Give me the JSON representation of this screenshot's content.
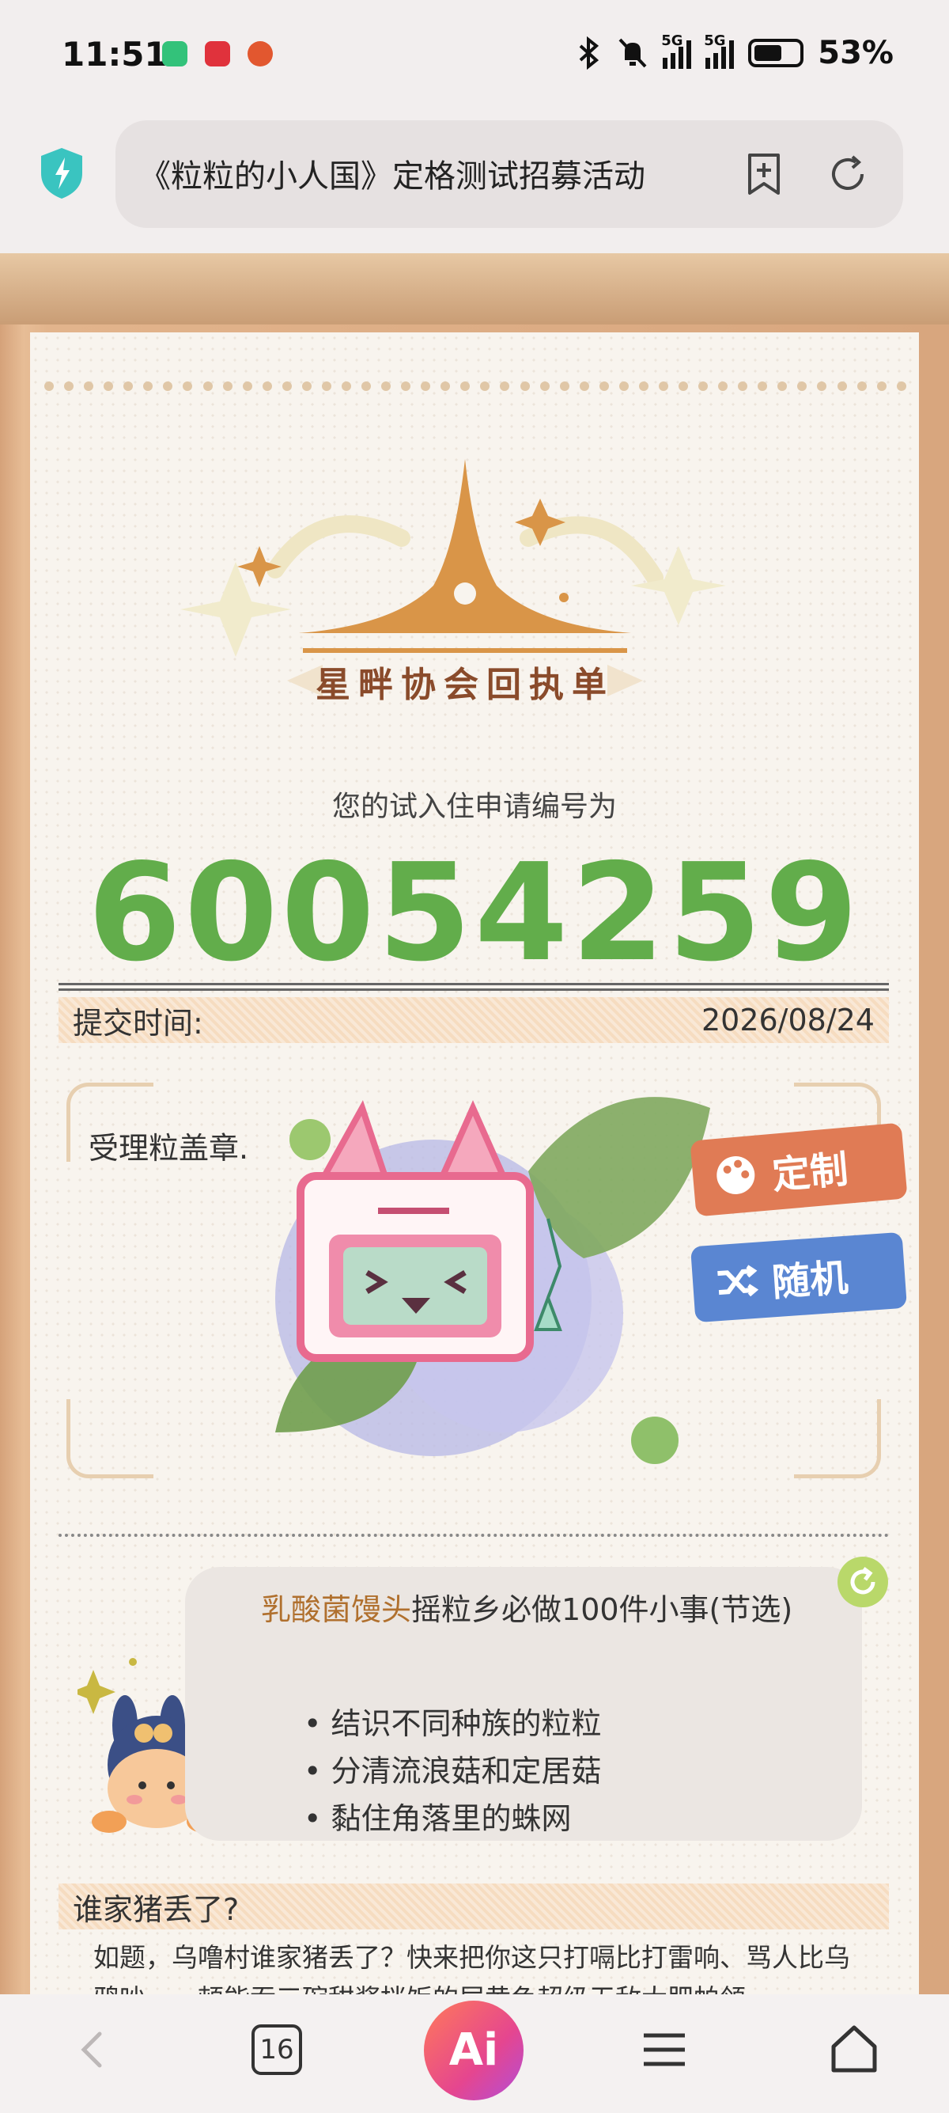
{
  "status_bar": {
    "time": "11:51",
    "battery": "53%",
    "network_1": "5G",
    "network_2": "5G"
  },
  "browser": {
    "url_title": "《粒粒的小人国》定格测试招募活动",
    "tab_count": "16",
    "ai_label": "Ai"
  },
  "page": {
    "header_logo_text": "星畔协会回执单",
    "caption": "您的试入住申请编号为",
    "application_number": "60054259",
    "submit_label": "提交时间:",
    "submit_date": "2026/08/24",
    "stamp_label": "受理粒盖章.",
    "btn_custom": "定制",
    "btn_random": "随机",
    "bubble": {
      "name": "乳酸菌馒头",
      "title_rest": "摇粒乡必做100件小事(节选)",
      "items": [
        "结识不同种族的粒粒",
        "分清流浪菇和定居菇",
        "黏住角落里的蛛网"
      ]
    },
    "lost_title": "谁家猪丢了?",
    "lost_body": "如题，乌噜村谁家猪丢了？快来把你这只打嗝比打雷响、骂人比乌鸦吵、一顿能吞三碗甜酱拌饭的屎黄色超级无敌大肥帕领"
  },
  "colors": {
    "number_green": "#62ad4b",
    "accent_orange": "#e07b55",
    "accent_blue": "#5a86d2",
    "logo_orange": "#d99548"
  }
}
